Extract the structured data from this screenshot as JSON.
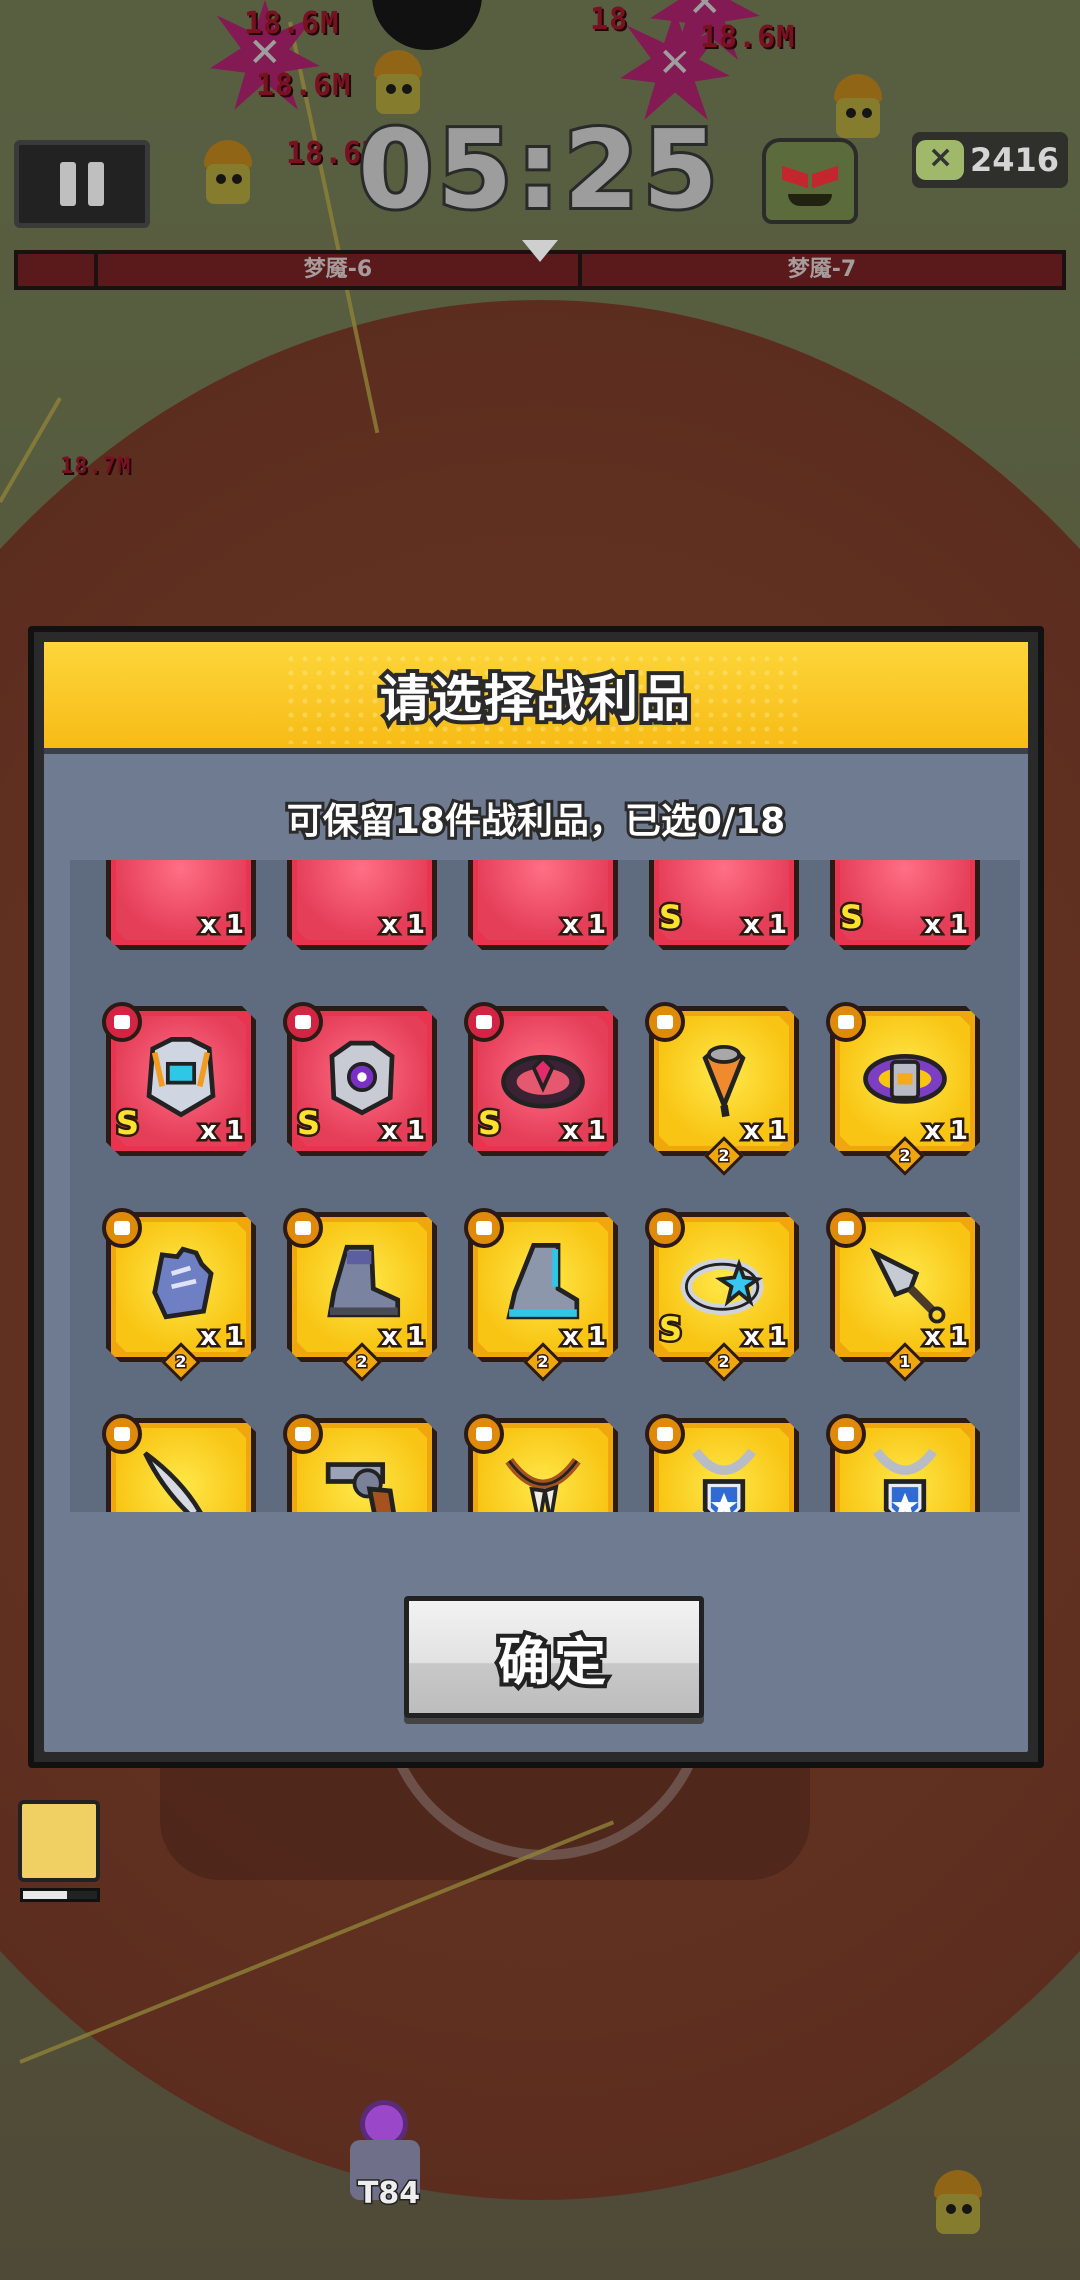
{
  "hud": {
    "timer": "05:25",
    "kill_count": "2416",
    "waves": [
      "",
      "梦魇-6",
      "梦魇-7"
    ],
    "damage_popups": [
      "18.6M",
      "18.6M",
      "18.6M",
      "18",
      "18.6M",
      "18.7M"
    ],
    "player_label": "T84"
  },
  "modal": {
    "title": "请选择战利品",
    "subtitle": "可保留18件战利品，已选0/18",
    "confirm_label": "确定",
    "selected": 0,
    "max": 18
  },
  "items": [
    {
      "rarity": "red",
      "icon": "partial-item-icon",
      "s": false,
      "count": "x 1",
      "tier": ""
    },
    {
      "rarity": "red",
      "icon": "partial-item-icon",
      "s": false,
      "count": "x 1",
      "tier": ""
    },
    {
      "rarity": "red",
      "icon": "partial-item-icon",
      "s": false,
      "count": "x 1",
      "tier": ""
    },
    {
      "rarity": "red",
      "icon": "partial-item-icon",
      "s": true,
      "count": "x 1",
      "tier": ""
    },
    {
      "rarity": "red",
      "icon": "partial-item-icon",
      "s": true,
      "count": "x 1",
      "tier": ""
    },
    {
      "rarity": "red",
      "icon": "mech-chestplate-icon",
      "s": true,
      "count": "x 1",
      "tier": ""
    },
    {
      "rarity": "red",
      "icon": "gear-chestplate-icon",
      "s": true,
      "count": "x 1",
      "tier": ""
    },
    {
      "rarity": "red",
      "icon": "dark-belt-icon",
      "s": true,
      "count": "x 1",
      "tier": ""
    },
    {
      "rarity": "gold",
      "icon": "drumstick-icon",
      "s": false,
      "count": "x 1",
      "tier": "2"
    },
    {
      "rarity": "gold",
      "icon": "purple-belt-icon",
      "s": false,
      "count": "x 1",
      "tier": "2"
    },
    {
      "rarity": "gold",
      "icon": "gauntlet-icon",
      "s": false,
      "count": "x 1",
      "tier": "2"
    },
    {
      "rarity": "gold",
      "icon": "boot-icon",
      "s": false,
      "count": "x 1",
      "tier": "2"
    },
    {
      "rarity": "gold",
      "icon": "tech-boot-icon",
      "s": false,
      "count": "x 1",
      "tier": "2"
    },
    {
      "rarity": "gold",
      "icon": "star-ring-icon",
      "s": true,
      "count": "x 1",
      "tier": "2"
    },
    {
      "rarity": "gold",
      "icon": "kunai-icon",
      "s": false,
      "count": "x 1",
      "tier": "1"
    },
    {
      "rarity": "gold",
      "icon": "machete-icon",
      "s": false,
      "count": "x 1",
      "tier": ""
    },
    {
      "rarity": "gold",
      "icon": "revolver-icon",
      "s": false,
      "count": "x 1",
      "tier": ""
    },
    {
      "rarity": "gold",
      "icon": "fang-necklace-icon",
      "s": false,
      "count": "x 1",
      "tier": ""
    },
    {
      "rarity": "gold",
      "icon": "badge-necklace-icon",
      "s": false,
      "count": "x 1",
      "tier": ""
    },
    {
      "rarity": "gold",
      "icon": "badge-necklace-icon",
      "s": false,
      "count": "x 1",
      "tier": ""
    }
  ],
  "colors": {
    "header_gold": "#f7bb16",
    "panel": "#6e7b90",
    "rarity_red": "#e8344f",
    "rarity_gold": "#f0a60d"
  }
}
